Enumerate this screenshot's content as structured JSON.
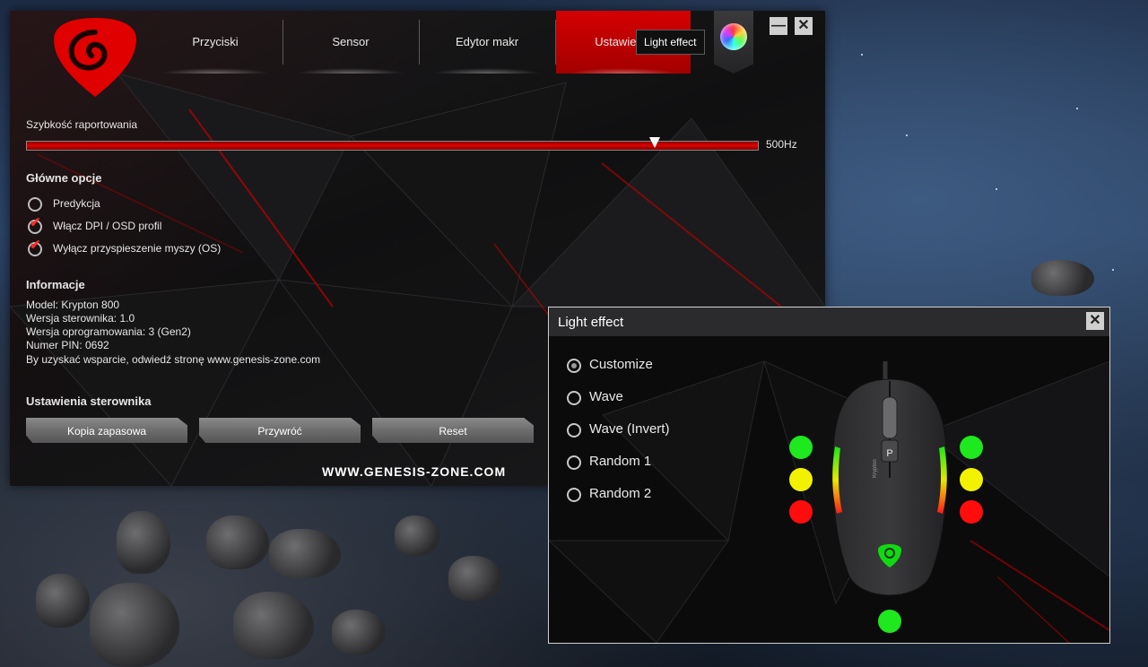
{
  "main": {
    "tabs": [
      {
        "label": "Przyciski"
      },
      {
        "label": "Sensor"
      },
      {
        "label": "Edytor makr"
      },
      {
        "label": "Ustawienia"
      }
    ],
    "tooltip": "Light effect",
    "window_buttons": {
      "minimize": "—",
      "close": "✕"
    },
    "report_rate": {
      "label": "Szybkość raportowania",
      "value": "500Hz",
      "level": 0.86
    },
    "main_options": {
      "heading": "Główne opcje",
      "items": [
        {
          "label": "Predykcja",
          "checked": false
        },
        {
          "label": "Włącz DPI / OSD profil",
          "checked": true
        },
        {
          "label": "Wyłącz przyspieszenie myszy (OS)",
          "checked": true
        }
      ]
    },
    "info": {
      "heading": "Informacje",
      "lines": [
        "Model: Krypton 800",
        "Wersja sterownika: 1.0",
        "Wersja oprogramowania: 3 (Gen2)",
        "Numer PIN: 0692",
        "By uzyskać wsparcie, odwiedź stronę www.genesis-zone.com"
      ]
    },
    "driver_settings": {
      "heading": "Ustawienia sterownika",
      "buttons": [
        "Kopia zapasowa",
        "Przywróć",
        "Reset"
      ]
    },
    "website": "WWW.GENESIS-ZONE.COM"
  },
  "light_effect": {
    "title": "Light effect",
    "close": "✕",
    "selected": "Customize",
    "options": [
      "Customize",
      "Wave",
      "Wave (Invert)",
      "Random 1",
      "Random 2"
    ],
    "mouse_labels": {
      "button_p": "P",
      "side_text": "Krypton"
    },
    "led_colors": {
      "green": "#1ee81e",
      "yellow": "#f2f200",
      "red": "#ff0d0d"
    }
  },
  "colors": {
    "accent": "#d40000"
  }
}
